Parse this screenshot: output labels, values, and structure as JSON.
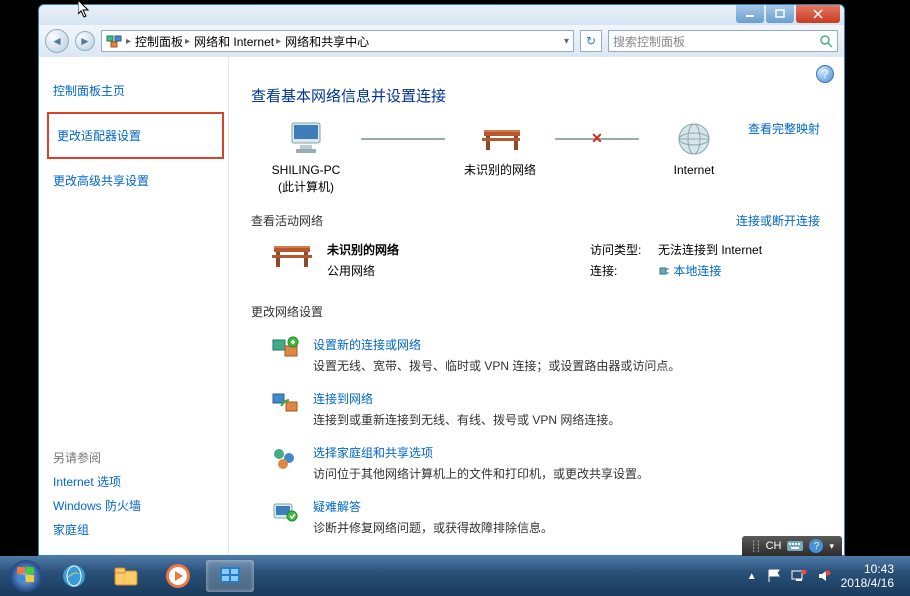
{
  "breadcrumb": {
    "seg1": "控制面板",
    "seg2": "网络和 Internet",
    "seg3": "网络和共享中心"
  },
  "search": {
    "placeholder": "搜索控制面板"
  },
  "sidebar": {
    "home": "控制面板主页",
    "adapter": "更改适配器设置",
    "advanced": "更改高级共享设置",
    "seealso_header": "另请参阅",
    "inetopt": "Internet 选项",
    "firewall": "Windows 防火墙",
    "homegroup": "家庭组"
  },
  "main": {
    "title": "查看基本网络信息并设置连接",
    "map_fulllink": "查看完整映射",
    "computer_name": "SHILING-PC",
    "computer_sub": "(此计算机)",
    "unidentified": "未识别的网络",
    "internet": "Internet",
    "active_hdr": "查看活动网络",
    "active_link": "连接或断开连接",
    "net_name": "未识别的网络",
    "net_type": "公用网络",
    "access_label": "访问类型:",
    "access_value": "无法连接到 Internet",
    "conn_label": "连接:",
    "conn_value": "本地连接",
    "change_hdr": "更改网络设置",
    "opt1_title": "设置新的连接或网络",
    "opt1_desc": "设置无线、宽带、拨号、临时或 VPN 连接；或设置路由器或访问点。",
    "opt2_title": "连接到网络",
    "opt2_desc": "连接到或重新连接到无线、有线、拨号或 VPN 网络连接。",
    "opt3_title": "选择家庭组和共享选项",
    "opt3_desc": "访问位于其他网络计算机上的文件和打印机，或更改共享设置。",
    "opt4_title": "疑难解答",
    "opt4_desc": "诊断并修复网络问题，或获得故障排除信息。"
  },
  "lang": {
    "label": "CH"
  },
  "clock": {
    "time": "10:43",
    "date": "2018/4/16"
  }
}
